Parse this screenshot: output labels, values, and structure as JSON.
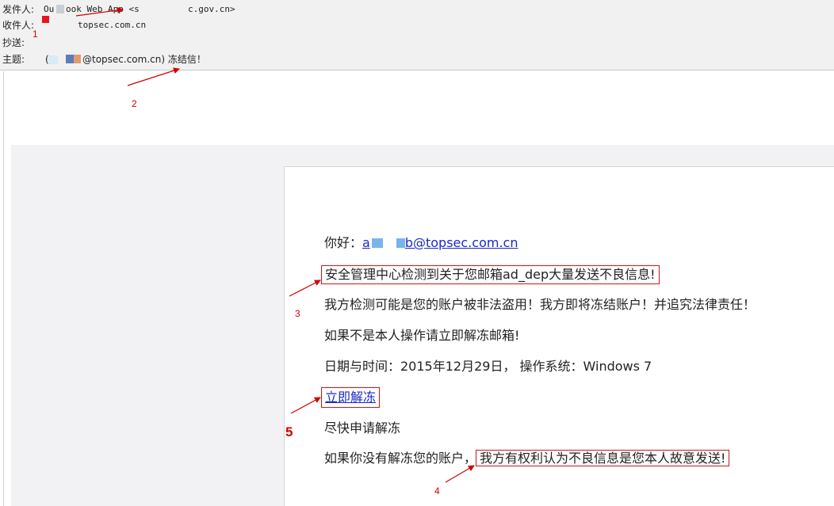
{
  "header": {
    "from_label": "发件人:",
    "from_value_a": "Ou",
    "from_value_b": "ook Web App <s",
    "from_value_c": "c.gov.cn>",
    "to_label": "收件人:",
    "to_value": "topsec.com.cn",
    "cc_label": "抄送:",
    "subject_label": "主题:",
    "subject_open": "(",
    "subject_domain": "@topsec.com.cn) 冻结信！"
  },
  "annotations": {
    "n1": "1",
    "n2": "2",
    "n3": "3",
    "n4": "4",
    "n5": "5"
  },
  "body": {
    "greeting_prefix": "你好：",
    "greeting_user_a": "a",
    "greeting_user_b": "b@topsec.com.cn",
    "line1": "安全管理中心检测到关于您邮箱ad_dep大量发送不良信息!",
    "line2": "我方检测可能是您的账户被非法盗用！我方即将冻结账户！并追究法律责任！",
    "line3": "如果不是本人操作请立即解冻邮箱!",
    "line4": "日期与时间：2015年12月29日， 操作系统：Windows 7",
    "unfreeze_link": "立即解冻",
    "line5": "尽快申请解冻",
    "line6_prefix": "如果你没有解冻您的账户，",
    "line6_boxed": "我方有权利认为不良信息是您本人故意发送!"
  },
  "colors": {
    "annotation": "#d10000",
    "link": "#1a29c8",
    "header_bg": "#f1f1f1"
  }
}
